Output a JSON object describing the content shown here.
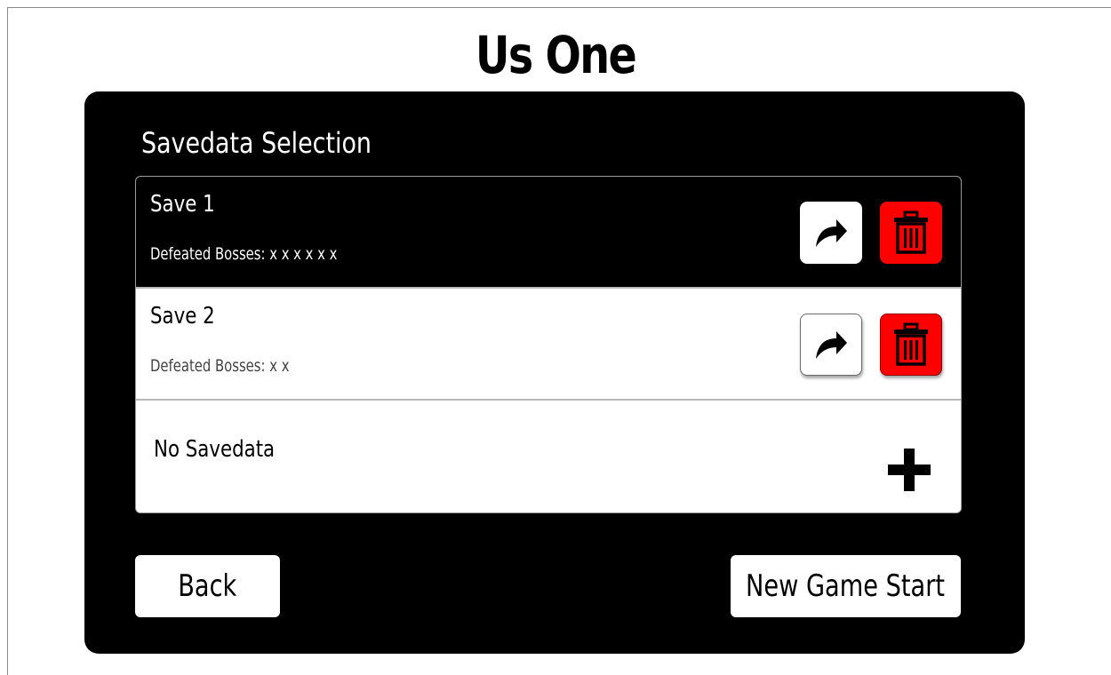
{
  "app": {
    "title": "Us One"
  },
  "panel": {
    "title": "Savedata Selection"
  },
  "saves": [
    {
      "name": "Save 1",
      "bosses": "Defeated Bosses: x x x x x x",
      "selected": true,
      "load_icon": "share-arrow-icon",
      "delete_icon": "trash-icon"
    },
    {
      "name": "Save 2",
      "bosses": "Defeated Bosses: x x",
      "selected": false,
      "load_icon": "share-arrow-icon",
      "delete_icon": "trash-icon"
    }
  ],
  "empty_slot": {
    "label": "No Savedata",
    "icon": "plus-icon"
  },
  "footer": {
    "back_label": "Back",
    "new_game_label": "New Game Start"
  },
  "colors": {
    "panel_background": "#000000",
    "delete_button": "#ff0000",
    "delete_icon": "#000000",
    "selected_row": "#000000",
    "row_background": "#ffffff"
  }
}
